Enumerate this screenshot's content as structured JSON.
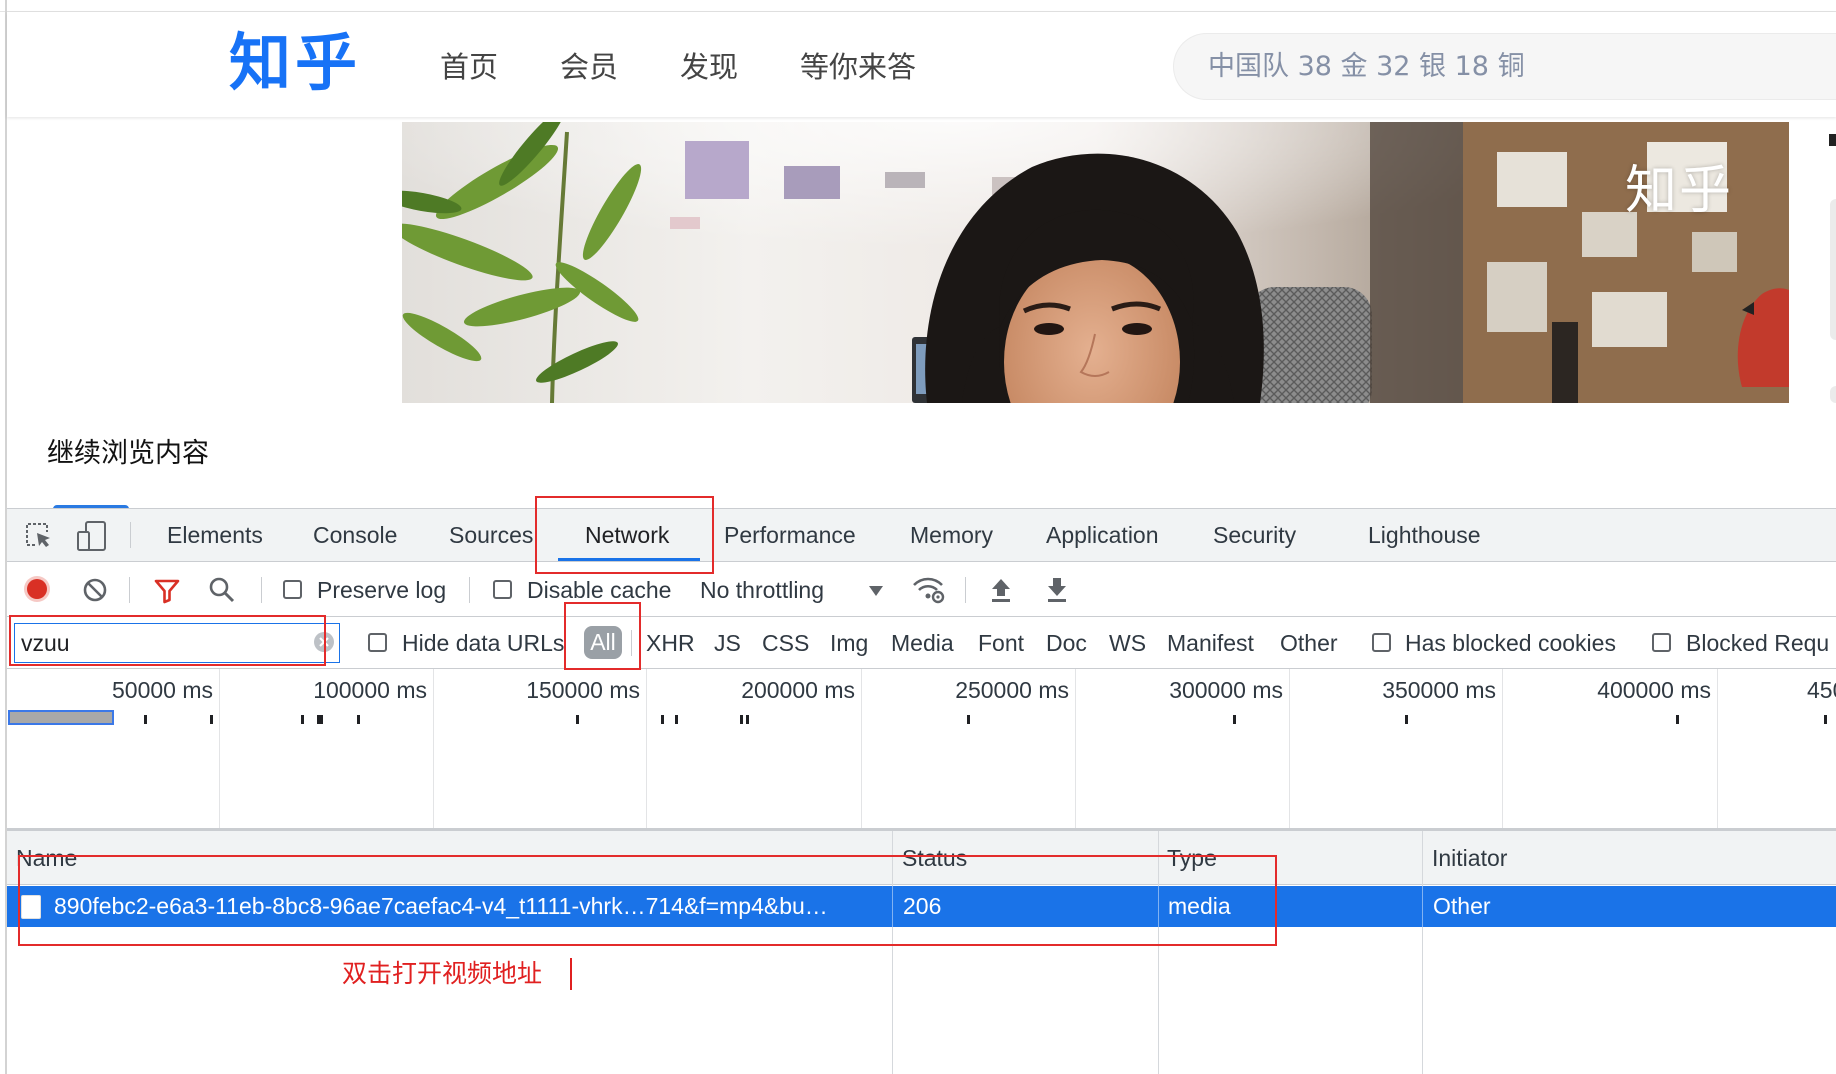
{
  "header": {
    "logo": "知乎",
    "nav": [
      {
        "label": "首页"
      },
      {
        "label": "会员"
      },
      {
        "label": "发现"
      },
      {
        "label": "等你来答"
      }
    ],
    "search_placeholder": "中国队 38 金 32 银 18 铜"
  },
  "video": {
    "watermark": "知乎"
  },
  "continue_browsing": "继续浏览内容",
  "devtools": {
    "tabs": [
      "Elements",
      "Console",
      "Sources",
      "Network",
      "Performance",
      "Memory",
      "Application",
      "Security",
      "Lighthouse"
    ],
    "selected_tab_index": 3,
    "toolbar": {
      "recording": true,
      "preserve_log": "Preserve log",
      "preserve_log_checked": false,
      "disable_cache": "Disable cache",
      "disable_cache_checked": false,
      "throttling": "No throttling"
    },
    "filter": {
      "value": "vzuu",
      "hide_data_urls": "Hide data URLs",
      "hide_data_urls_checked": false,
      "types": [
        "All",
        "XHR",
        "JS",
        "CSS",
        "Img",
        "Media",
        "Font",
        "Doc",
        "WS",
        "Manifest",
        "Other"
      ],
      "selected_type_index": 0,
      "has_blocked_cookies": "Has blocked cookies",
      "has_blocked_cookies_checked": false,
      "blocked_requests": "Blocked Requ",
      "blocked_requests_checked": false
    },
    "overview": {
      "time_labels": [
        "50000 ms",
        "100000 ms",
        "150000 ms",
        "200000 ms",
        "250000 ms",
        "300000 ms",
        "350000 ms",
        "400000 ms",
        "450"
      ]
    },
    "columns": [
      "Name",
      "Status",
      "Type",
      "Initiator"
    ],
    "rows": [
      {
        "name": "890febc2-e6a3-11eb-8bc8-96ae7caefac4-v4_t1111-vhrk…714&f=mp4&bu…",
        "status": "206",
        "type": "media",
        "initiator": "Other",
        "selected": true
      }
    ]
  },
  "annotation": {
    "text": "双击打开视频地址"
  },
  "icons": [
    "inspect-element-icon",
    "device-toolbar-icon",
    "record-icon",
    "clear-icon",
    "filter-icon",
    "search-icon",
    "dropdown-arrow-icon",
    "network-conditions-icon",
    "import-har-icon",
    "export-har-icon",
    "clear-filter-icon",
    "file-icon"
  ],
  "colors": {
    "brand": "#1772f6",
    "selected_row": "#1a73e8",
    "tab_underline": "#1a73e8",
    "record": "#d93025",
    "annotation": "#e32b2b"
  }
}
